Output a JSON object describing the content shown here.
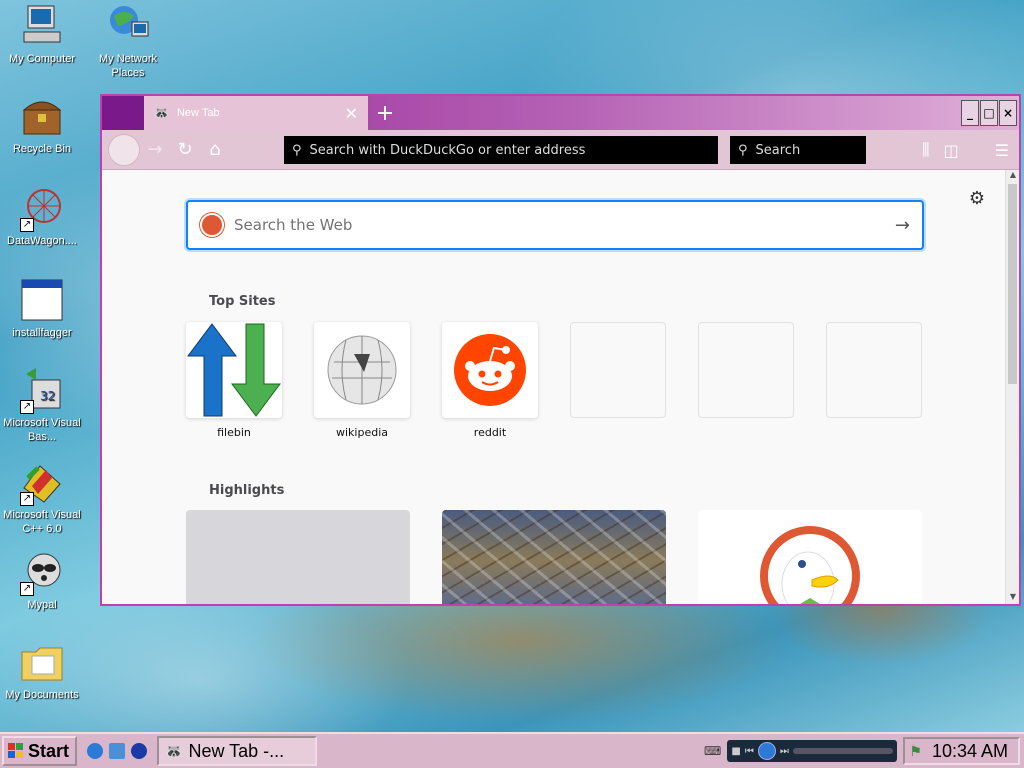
{
  "desktop": {
    "icons": [
      {
        "label": "My Computer"
      },
      {
        "label": "My Network Places"
      },
      {
        "label": "Recycle Bin"
      },
      {
        "label": "DataWagon...."
      },
      {
        "label": "installfagger"
      },
      {
        "label": "Microsoft Visual Bas..."
      },
      {
        "label": "Microsoft Visual C++ 6.0"
      },
      {
        "label": "Mypal"
      },
      {
        "label": "My Documents"
      }
    ]
  },
  "browser": {
    "tab_title": "New Tab",
    "tab_close": "✕",
    "new_tab": "+",
    "url_placeholder": "Search with DuckDuckGo or enter address",
    "search_placeholder": "Search",
    "newtab": {
      "web_search_placeholder": "Search the Web",
      "top_sites_title": "Top Sites",
      "top_sites": [
        {
          "name": "filebin"
        },
        {
          "name": "wikipedia"
        },
        {
          "name": "reddit"
        },
        {
          "name": ""
        },
        {
          "name": ""
        },
        {
          "name": ""
        }
      ],
      "highlights_title": "Highlights"
    }
  },
  "taskbar": {
    "start_label": "Start",
    "task_label": "New Tab -...",
    "clock": "10:34 AM"
  }
}
